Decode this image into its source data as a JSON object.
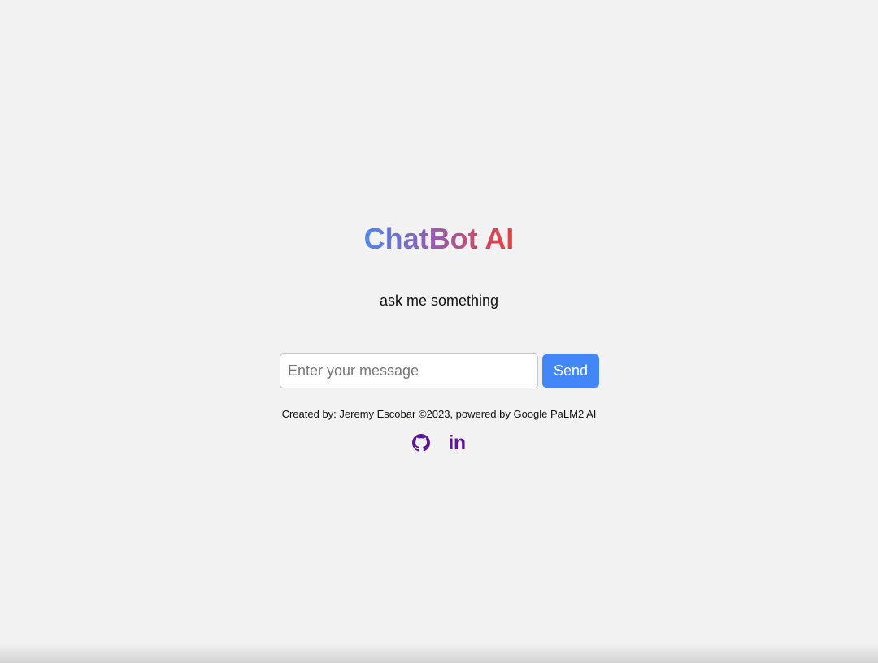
{
  "header": {
    "title": "ChatBot AI",
    "subtitle": "ask me something"
  },
  "chat": {
    "input_placeholder": "Enter your message",
    "input_value": "",
    "send_label": "Send"
  },
  "footer": {
    "credits": "Created by: Jeremy Escobar ©2023, powered by Google PaLM2 AI",
    "links": [
      {
        "icon": "github-icon"
      },
      {
        "icon": "linkedin-icon",
        "glyph": "in"
      }
    ]
  },
  "colors": {
    "background": "#f2f2f2",
    "title_gradient_start": "#4f86e8",
    "title_gradient_end": "#e8413c",
    "send_button": "#4287f5",
    "social_icon": "#5a189a"
  }
}
